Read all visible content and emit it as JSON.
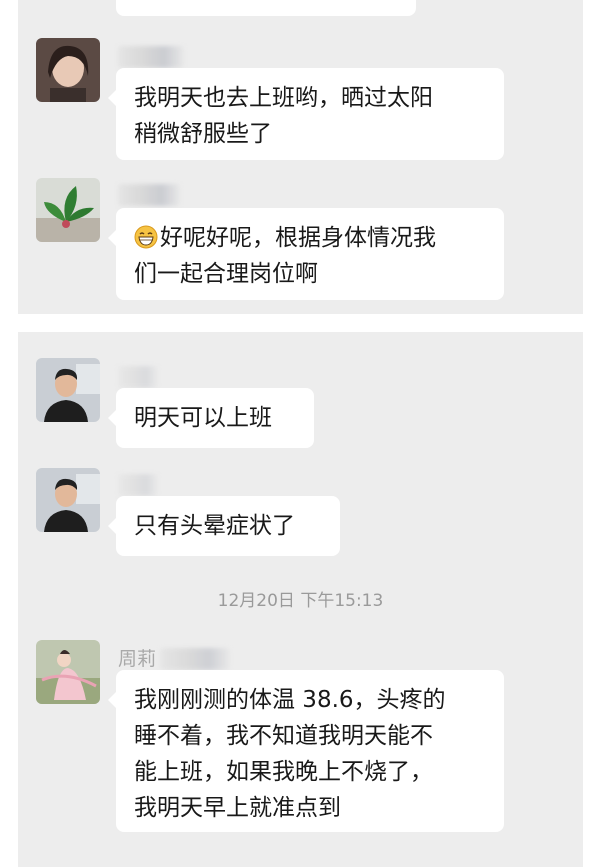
{
  "panel1": {
    "messages": [
      {
        "lines": [
          "我明天也去上班哟，晒过太阳",
          "稍微舒服些了"
        ]
      },
      {
        "lines": [
          "好呢好呢，根据身体情况我",
          "们一起合理岗位啊"
        ],
        "emoji": "grinning-face-icon"
      }
    ]
  },
  "panel2": {
    "messages": [
      {
        "lines": [
          "明天可以上班"
        ]
      },
      {
        "lines": [
          "只有头晕症状了"
        ]
      }
    ],
    "timestamp": "12月20日 下午15:13",
    "last_sender_name": "周莉",
    "last_message": {
      "lines": [
        "我刚刚测的体温 38.6，头疼的",
        "睡不着，我不知道我明天能不",
        "能上班，如果我晚上不烧了，",
        "我明天早上就准点到"
      ]
    }
  },
  "colors": {
    "chat_background": "#ededed",
    "bubble": "#ffffff",
    "text": "#191919",
    "timestamp": "#9a9a9a"
  }
}
